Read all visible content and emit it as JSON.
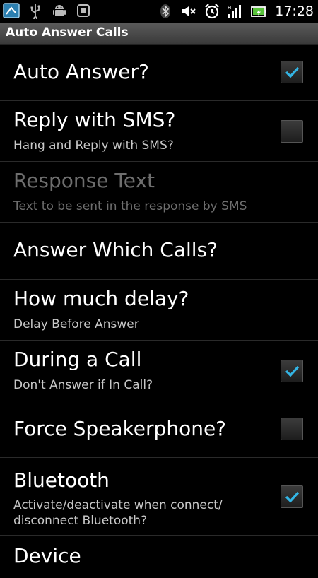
{
  "status_bar": {
    "time": "17:28",
    "left_icons": [
      "app-notification-icon",
      "usb-icon",
      "android-debug-icon",
      "screenshot-icon"
    ],
    "right_icons": [
      "bluetooth-icon",
      "mute-icon",
      "alarm-icon",
      "signal-icon",
      "battery-icon"
    ]
  },
  "app": {
    "title": "Auto Answer Calls"
  },
  "settings": [
    {
      "title": "Auto Answer?",
      "checkbox": true,
      "checked": true
    },
    {
      "title": "Reply with SMS?",
      "summary": "Hang and Reply with SMS?",
      "checkbox": true,
      "checked": false
    },
    {
      "title": "Response Text",
      "summary": "Text to be sent in the response by SMS",
      "disabled": true
    },
    {
      "title": "Answer Which Calls?"
    },
    {
      "title": "How much delay?",
      "summary": "Delay Before Answer"
    },
    {
      "title": "During a Call",
      "summary": "Don't Answer if In Call?",
      "checkbox": true,
      "checked": true
    },
    {
      "title": "Force Speakerphone?",
      "checkbox": true,
      "checked": false
    },
    {
      "title": "Bluetooth",
      "summary": "Activate/deactivate when connect/ disconnect Bluetooth?",
      "checkbox": true,
      "checked": true
    },
    {
      "title": "Device"
    }
  ],
  "colors": {
    "accent_check": "#33b5e5",
    "title_bar": "#4a4a4a",
    "background": "#000000"
  }
}
